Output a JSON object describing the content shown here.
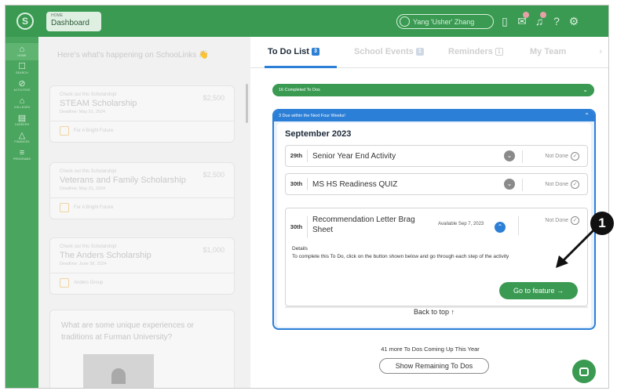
{
  "topbar": {
    "logo": "S",
    "breadcrumb_small": "HOME",
    "breadcrumb_title": "Dashboard",
    "user_name": "Yang 'Usher' Zhang",
    "icons": [
      "document-icon",
      "mail-icon",
      "bell-icon",
      "help-icon",
      "gear-icon"
    ]
  },
  "sidebar": {
    "items": [
      {
        "label": "HOME",
        "icon": "home-icon"
      },
      {
        "label": "SEARCH",
        "icon": "search-icon"
      },
      {
        "label": "ACTIVITIES",
        "icon": "activities-icon"
      },
      {
        "label": "COLLEGES",
        "icon": "colleges-icon"
      },
      {
        "label": "CAREERS",
        "icon": "careers-icon"
      },
      {
        "label": "FINANCES",
        "icon": "finances-icon"
      },
      {
        "label": "PROGRAMS",
        "icon": "programs-icon"
      }
    ]
  },
  "left": {
    "greeting": "Here's what's happening on SchooLinks 👋",
    "cards": [
      {
        "check": "Check out this Scholarship!",
        "amount": "$2,500",
        "name": "STEAM Scholarship",
        "deadline": "Deadline: May 31, 2024",
        "org": "For A Bright Future"
      },
      {
        "check": "Check out this Scholarship!",
        "amount": "$2,500",
        "name": "Veterans and Family Scholarship",
        "deadline": "Deadline: May 31, 2024",
        "org": "For A Bright Future"
      },
      {
        "check": "Check out this Scholarship!",
        "amount": "$1,000",
        "name": "The Anders Scholarship",
        "deadline": "Deadline: June 28, 2024",
        "org": "Anders Group"
      }
    ],
    "question": "What are some unique experiences or traditions at Furman University?"
  },
  "tabs": [
    {
      "label": "To Do List",
      "count": "3"
    },
    {
      "label": "School Events",
      "count": "1"
    },
    {
      "label": "Reminders",
      "count": "1"
    },
    {
      "label": "My Team",
      "count": ""
    }
  ],
  "completed": {
    "label": "16 Completed To Dos"
  },
  "due": {
    "header": "3 Due within the Next Four Weeks!",
    "month": "September 2023",
    "rows": [
      {
        "date": "29th",
        "title": "Senior Year End Activity",
        "status": "Not Done"
      },
      {
        "date": "30th",
        "title": "MS HS Readiness QUIZ",
        "status": "Not Done"
      }
    ],
    "expanded": {
      "date": "30th",
      "title": "Recommendation Letter Brag Sheet",
      "available": "Available Sep 7, 2023",
      "status": "Not Done",
      "details_label": "Details",
      "description": "To complete this To Do, click on the button shown below and go through each step of the activity",
      "button": "Go to feature →"
    },
    "back_to_top": "Back to top ↑"
  },
  "footer": {
    "more_text": "41 more To Dos Coming Up This Year",
    "show_button": "Show Remaining To Dos"
  },
  "annotation": {
    "number": "1"
  }
}
